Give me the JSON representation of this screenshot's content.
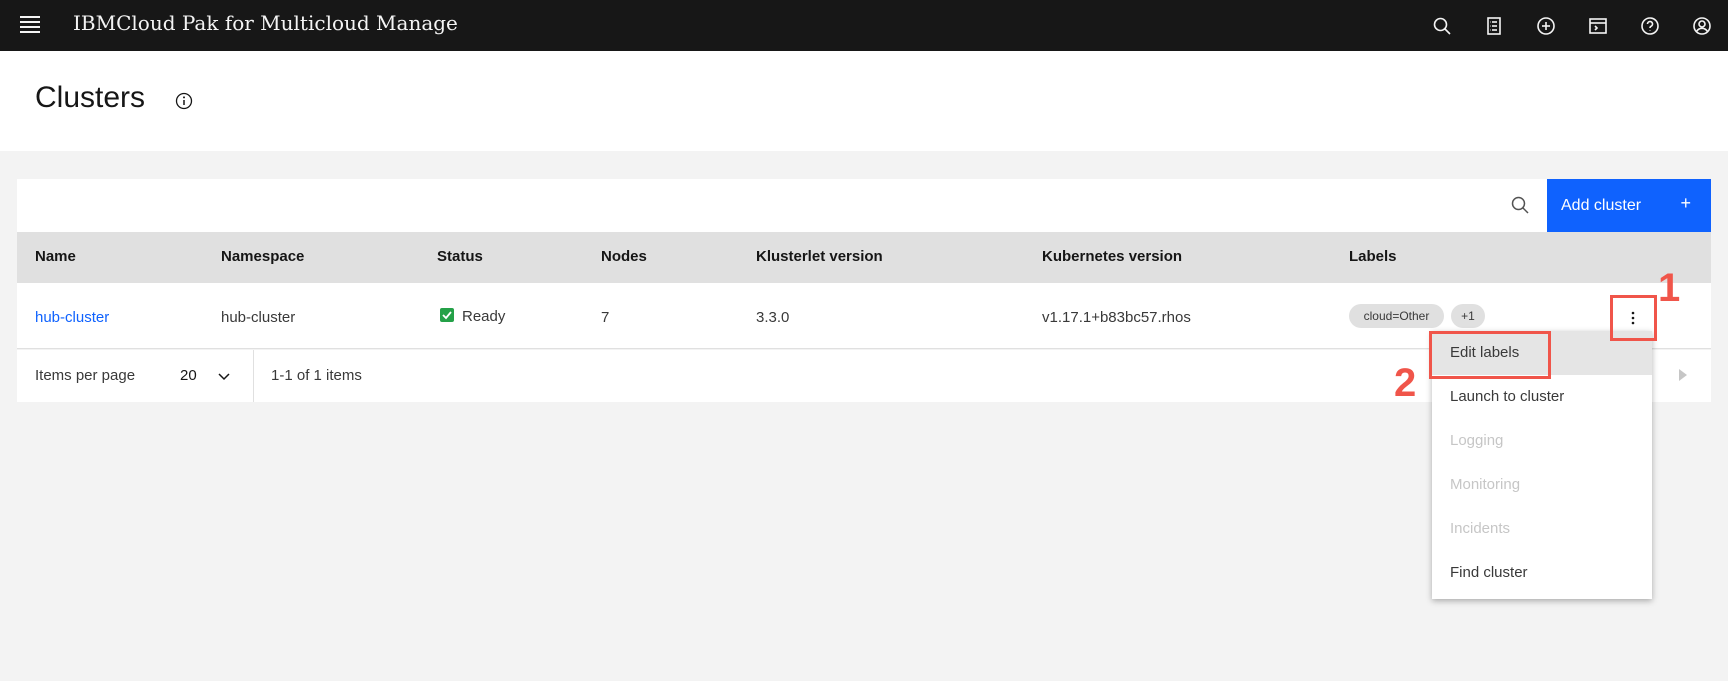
{
  "header": {
    "brand": "IBMCloud Pak for Multicloud Manage",
    "icons": [
      "search-icon",
      "catalog-icon",
      "add-icon",
      "terminal-icon",
      "help-icon",
      "user-icon"
    ]
  },
  "page": {
    "title": "Clusters"
  },
  "toolbar": {
    "add_label": "Add cluster",
    "add_icon": "+"
  },
  "table": {
    "columns": [
      "Name",
      "Namespace",
      "Status",
      "Nodes",
      "Klusterlet version",
      "Kubernetes version",
      "Labels"
    ],
    "rows": [
      {
        "name": "hub-cluster",
        "namespace": "hub-cluster",
        "status": "Ready",
        "nodes": "7",
        "klusterlet": "3.3.0",
        "kubernetes": "v1.17.1+b83bc57.rhos",
        "labels": [
          "cloud=Other",
          "+1"
        ]
      }
    ]
  },
  "pagination": {
    "items_per_page_label": "Items per page",
    "items_per_page_value": "20",
    "range_text": "1-1 of 1 items"
  },
  "overflow_menu": {
    "items": [
      {
        "label": "Edit labels",
        "disabled": false
      },
      {
        "label": "Launch to cluster",
        "disabled": false
      },
      {
        "label": "Logging",
        "disabled": true
      },
      {
        "label": "Monitoring",
        "disabled": true
      },
      {
        "label": "Incidents",
        "disabled": true
      },
      {
        "label": "Find cluster",
        "disabled": false
      }
    ]
  },
  "annotations": {
    "step1": "1",
    "step2": "2",
    "color": "#f0554a"
  },
  "colors": {
    "primary": "#0f62fe",
    "success": "#24a148",
    "header_bg": "#171717"
  }
}
